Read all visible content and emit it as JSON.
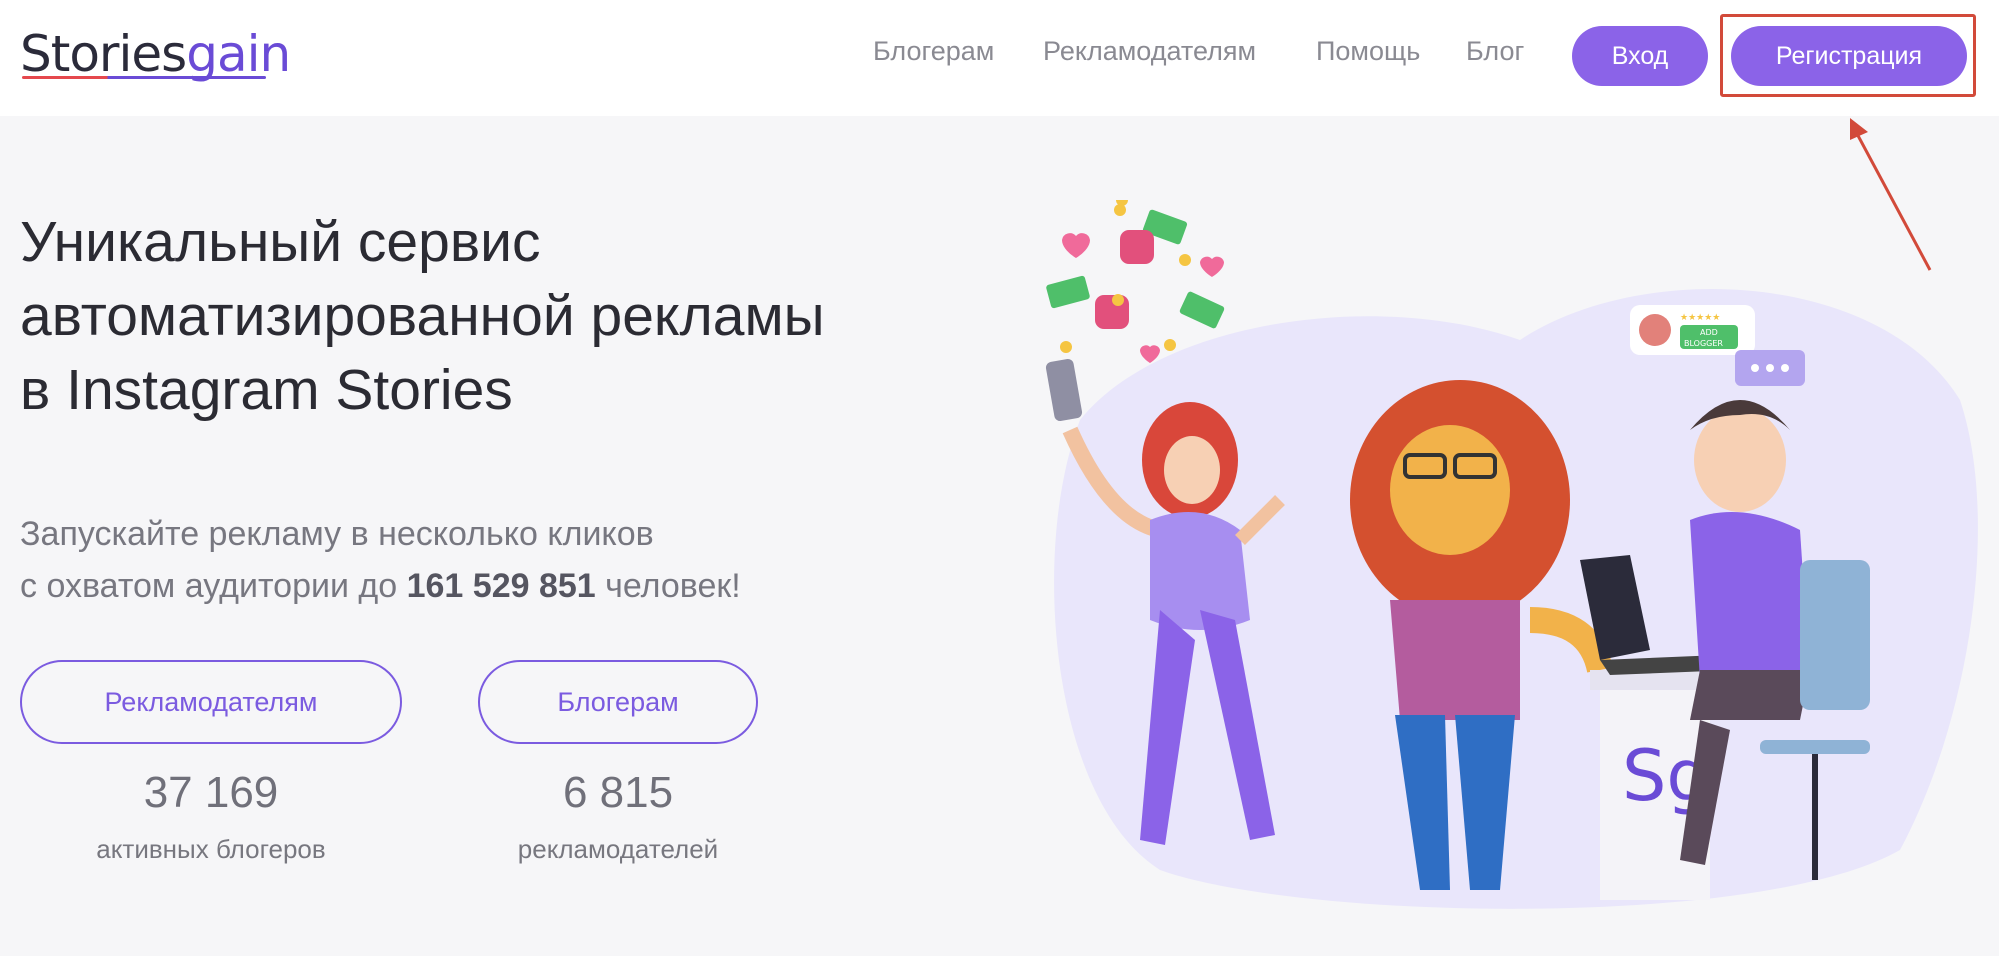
{
  "header": {
    "logo": {
      "part1": "Stories",
      "part2": "gain"
    },
    "nav": [
      {
        "label": "Блогерам"
      },
      {
        "label": "Рекламодателям"
      },
      {
        "label": "Помощь"
      },
      {
        "label": "Блог"
      }
    ],
    "login_label": "Вход",
    "register_label": "Регистрация"
  },
  "hero": {
    "title_line1": "Уникальный сервис",
    "title_line2": "автоматизированной рекламы",
    "title_line3": "в Instagram Stories",
    "subtitle_line1": "Запускайте рекламу в несколько кликов",
    "subtitle_line2_prefix": "с охватом аудитории до ",
    "subtitle_number": "161 529 851",
    "subtitle_line2_suffix": " человек!",
    "buttons": {
      "advertisers": "Рекламодателям",
      "bloggers": "Блогерам"
    },
    "stats": [
      {
        "value": "37 169",
        "label": "активных блогеров"
      },
      {
        "value": "6 815",
        "label": "рекламодателей"
      }
    ]
  },
  "illustration": {
    "badge_text_line1": "ADD",
    "badge_text_line2": "BLOGGER",
    "stars": "★★★★★",
    "logo_mark": "Sg"
  },
  "colors": {
    "accent": "#8b63e8",
    "highlight": "#d24a3a",
    "background": "#f6f6f8"
  }
}
